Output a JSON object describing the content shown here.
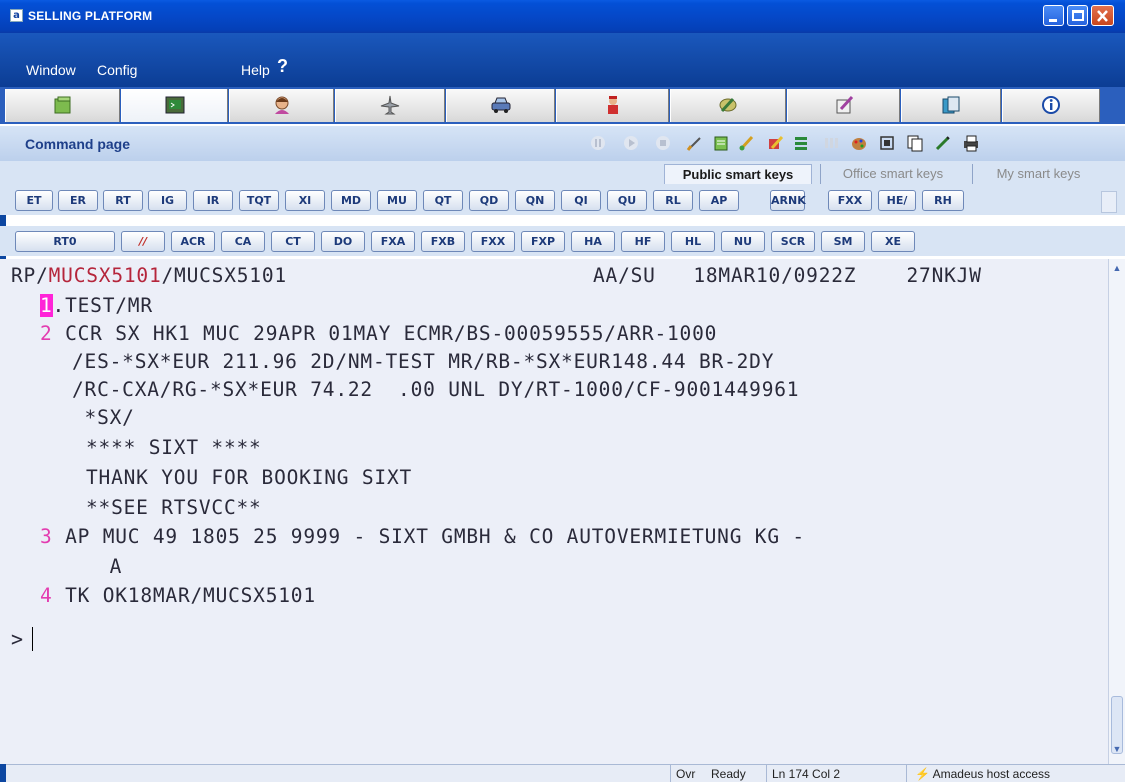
{
  "window": {
    "title": "SELLING PLATFORM"
  },
  "menu": {
    "items": [
      "Window",
      "Config",
      "Help"
    ],
    "help_glyph": "?"
  },
  "tabs": [
    {
      "icon": "folder-icon"
    },
    {
      "icon": "terminal-icon",
      "active": true
    },
    {
      "icon": "agent-icon"
    },
    {
      "icon": "flight-icon"
    },
    {
      "icon": "car-icon"
    },
    {
      "icon": "hotel-icon"
    },
    {
      "icon": "tools-icon"
    },
    {
      "icon": "notes-icon"
    },
    {
      "icon": "documents-icon"
    },
    {
      "icon": "info-icon"
    }
  ],
  "command_page": {
    "title": "Command page"
  },
  "smart_keys": {
    "tabs": [
      "Public smart keys",
      "Office smart keys",
      "My smart keys"
    ],
    "row1": [
      "ET",
      "ER",
      "RT",
      "IG",
      "IR",
      "TQT",
      "XI",
      "MD",
      "MU",
      "QT",
      "QD",
      "QN",
      "QI",
      "QU",
      "RL",
      "AP",
      "ARNK",
      "FXX",
      "HE/",
      "RH"
    ],
    "row2": [
      "RT0",
      "//",
      "ACR",
      "CA",
      "CT",
      "DO",
      "FXA",
      "FXB",
      "FXX",
      "FXP",
      "HA",
      "HF",
      "HL",
      "NU",
      "SCR",
      "SM",
      "XE"
    ]
  },
  "terminal": {
    "header": {
      "prefix": "RP/",
      "office1": "MUCSX5101",
      "mid": "/MUCSX5101",
      "right": "AA/SU   18MAR10/0922Z    27NKJW"
    },
    "lines": [
      {
        "num": "1",
        "text": ".TEST/MR"
      },
      {
        "num": "2",
        "text": " CCR SX HK1 MUC 29APR 01MAY ECMR/BS-00059555/ARR-1000"
      },
      {
        "num": "",
        "text": "/ES-*SX*EUR 211.96 2D/NM-TEST MR/RB-*SX*EUR148.44 BR-2DY"
      },
      {
        "num": "",
        "text": "/RC-CXA/RG-*SX*EUR 74.22  .00 UNL DY/RT-1000/CF-9001449961"
      },
      {
        "num": "",
        "text": " *SX/"
      },
      {
        "num": "",
        "text": "**** SIXT ****"
      },
      {
        "num": "",
        "text": "THANK YOU FOR BOOKING SIXT"
      },
      {
        "num": "",
        "text": "**SEE RTSVCC**"
      },
      {
        "num": "3",
        "text": " AP MUC 49 1805 25 9999 - SIXT GMBH & CO AUTOVERMIETUNG KG -"
      },
      {
        "num": "",
        "text": "   A"
      },
      {
        "num": "4",
        "text": " TK OK18MAR/MUCSX5101"
      }
    ],
    "prompt": ">"
  },
  "status": {
    "mode": "Ovr",
    "state": "Ready",
    "position": "Ln 174 Col 2",
    "connection": "Amadeus host access"
  },
  "colors": {
    "titlebar": "#0548c8",
    "menubar": "#0d47a1",
    "pink_number": "#e33cb0",
    "terminal_bg": "#eceff8"
  }
}
